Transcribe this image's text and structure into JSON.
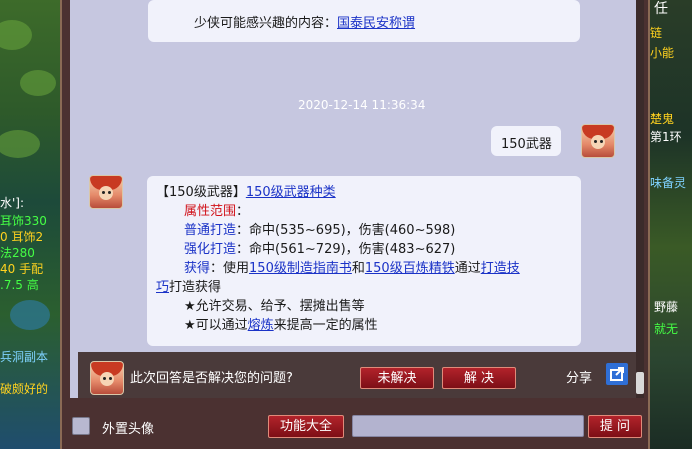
{
  "background": {
    "left_texts": [
      {
        "text": "水']:",
        "color": "#ffffff"
      },
      {
        "text": "耳饰330",
        "color": "#45ff45"
      },
      {
        "text": "0 耳饰2",
        "color": "#ffd21f"
      },
      {
        "text": "法280",
        "color": "#45ff45"
      },
      {
        "text": "40 手配",
        "color": "#ffd21f"
      },
      {
        "text": ".7.5 高",
        "color": "#45ff45"
      },
      {
        "text": "兵洞副本",
        "color": "#7fd3ff"
      },
      {
        "text": "破颇好的",
        "color": "#ffd21f"
      }
    ],
    "right_texts": [
      {
        "text": "任",
        "color": "#ffffff"
      },
      {
        "text": "链",
        "color": "#ffd21f"
      },
      {
        "text": "小能",
        "color": "#ffd21f"
      },
      {
        "text": "楚鬼",
        "color": "#ffd21f"
      },
      {
        "text": "第1环",
        "color": "#ffffff"
      },
      {
        "text": "味备灵",
        "color": "#7fd3ff"
      },
      {
        "text": "野藤",
        "color": "#ffffff"
      },
      {
        "text": "就无",
        "color": "#45ff45"
      }
    ]
  },
  "chat": {
    "top_message": {
      "prefix": "少侠可能感兴趣的内容：",
      "link": "国泰民安称谓"
    },
    "timestamp": "2020-12-14 11:36:34",
    "user_message": "150武器",
    "answer": {
      "title_bracket": "【150级武器】",
      "title_link": "150级武器种类",
      "range_label": "属性范围",
      "range_colon": "：",
      "normal_label": "普通打造",
      "normal_value": "：命中(535~695)，伤害(460~598)",
      "strong_label": "强化打造",
      "strong_value": "：命中(561~729)，伤害(483~627)",
      "obtain_label": "获得",
      "obtain_prefix": "：使用",
      "obtain_link1": "150级制造指南书",
      "obtain_and": "和",
      "obtain_link2": "150级百炼精铁",
      "obtain_via": "通过",
      "obtain_link3a": "打造技",
      "obtain_link3b": "巧",
      "obtain_suffix": "打造获得",
      "bullet1": "★允许交易、给予、摆摊出售等",
      "bullet2_prefix": "★可以通过",
      "bullet2_link": "熔炼",
      "bullet2_suffix": "来提高一定的属性"
    }
  },
  "feedback": {
    "question": "此次回答是否解决您的问题?",
    "unresolved_label": "未解决",
    "resolved_label": "解 决",
    "share_label": "分享"
  },
  "bottom": {
    "avatar_toggle_label": "外置头像",
    "features_label": "功能大全",
    "ask_label": "提 问",
    "input_value": ""
  }
}
